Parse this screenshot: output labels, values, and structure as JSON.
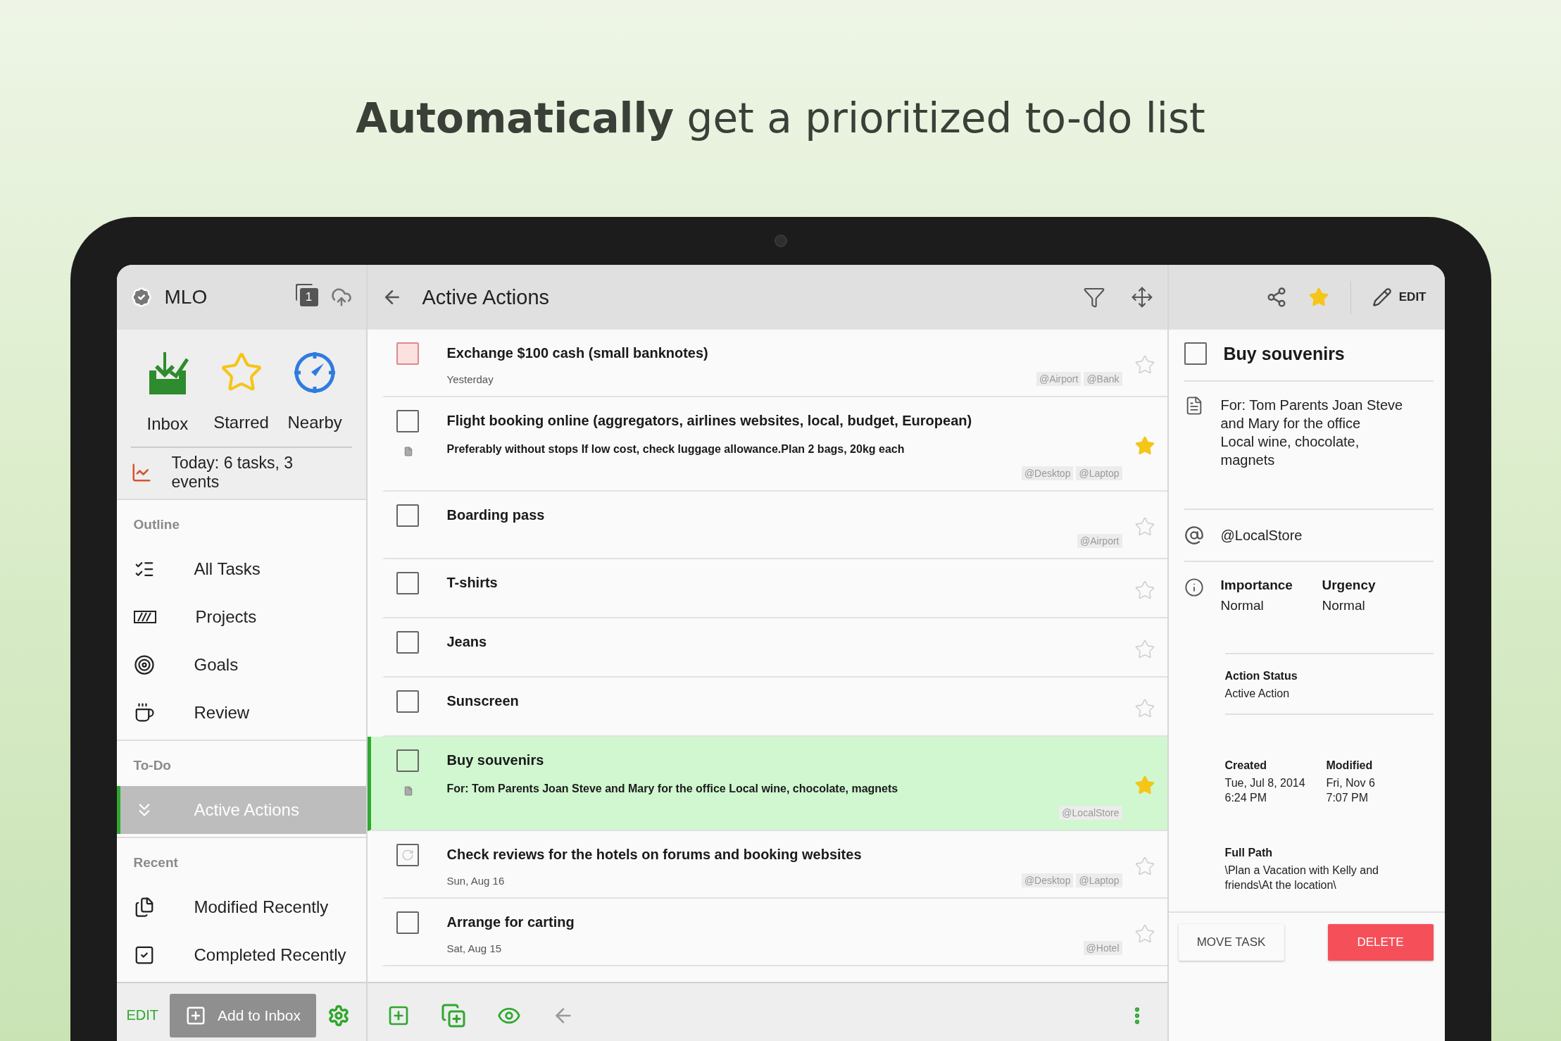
{
  "headline": "**Automatically** get a prioritized to-do list",
  "sidebar": {
    "app_name": "MLO",
    "sync_count": "1",
    "quick": [
      {
        "label": "Inbox",
        "kind": "inbox"
      },
      {
        "label": "Starred",
        "kind": "starred"
      },
      {
        "label": "Nearby",
        "kind": "nearby"
      }
    ],
    "today": "Today: 6 tasks, 3 events",
    "sections": [
      {
        "heading": "Outline",
        "items": [
          {
            "label": "All Tasks",
            "kind": "all",
            "selected": false
          },
          {
            "label": "Projects",
            "kind": "projects",
            "selected": false
          },
          {
            "label": "Goals",
            "kind": "goals",
            "selected": false
          },
          {
            "label": "Review",
            "kind": "review",
            "selected": false
          }
        ]
      },
      {
        "heading": "To-Do",
        "items": [
          {
            "label": "Active Actions",
            "kind": "active",
            "selected": true
          }
        ]
      },
      {
        "heading": "Recent",
        "items": [
          {
            "label": "Modified Recently",
            "kind": "modified",
            "selected": false
          },
          {
            "label": "Completed Recently",
            "kind": "completed",
            "selected": false
          }
        ]
      }
    ],
    "edit": "EDIT",
    "add_button": "Add to Inbox"
  },
  "list": {
    "title": "Active Actions",
    "tasks": [
      {
        "title": "Exchange $100 cash (small banknotes)",
        "kind": "overdue",
        "checked": false,
        "subtitle": "Yesterday",
        "tags": [
          "@Airport",
          "@Bank"
        ],
        "starred": false,
        "selected": false
      },
      {
        "title": "Flight booking online (aggregators, airlines websites, local, budget, European)",
        "kind": "plain",
        "checked": false,
        "note": "Preferably without stops If low cost, check luggage allowance.Plan 2 bags, 20kg each",
        "tags": [
          "@Desktop",
          "@Laptop"
        ],
        "starred": true,
        "selected": false
      },
      {
        "title": "Boarding pass",
        "kind": "plain",
        "checked": false,
        "tags": [
          "@Airport"
        ],
        "starred": false,
        "selected": false
      },
      {
        "title": "T-shirts",
        "kind": "plain",
        "checked": false,
        "starred": false,
        "selected": false
      },
      {
        "title": "Jeans",
        "kind": "plain",
        "checked": false,
        "starred": false,
        "selected": false
      },
      {
        "title": "Sunscreen",
        "kind": "plain",
        "checked": false,
        "starred": false,
        "selected": false
      },
      {
        "title": "Buy souvenirs",
        "kind": "plain",
        "checked": false,
        "note": "For: Tom Parents Joan Steve and Mary for the office Local wine, chocolate, magnets",
        "tags": [
          "@LocalStore"
        ],
        "starred": true,
        "selected": true
      },
      {
        "title": "Check reviews for the hotels on forums and booking websites",
        "kind": "recurring",
        "checked": false,
        "subtitle": "Sun, Aug 16",
        "tags": [
          "@Desktop",
          "@Laptop"
        ],
        "starred": false,
        "selected": false
      },
      {
        "title": "Arrange for carting",
        "kind": "plain",
        "checked": false,
        "subtitle": "Sat, Aug 15",
        "tags": [
          "@Hotel"
        ],
        "starred": false,
        "selected": false
      }
    ]
  },
  "detail": {
    "checked": false,
    "starred": true,
    "edit": "EDIT",
    "title": "Buy souvenirs",
    "note": "For: Tom Parents Joan Steve and Mary for the office\nLocal wine, chocolate, magnets",
    "context": "@LocalStore",
    "importance": {
      "label": "Importance",
      "value": "Normal"
    },
    "urgency": {
      "label": "Urgency",
      "value": "Normal"
    },
    "action_status": {
      "label": "Action Status",
      "value": "Active Action"
    },
    "created": {
      "label": "Created",
      "value": "Tue, Jul 8, 2014\n6:24 PM"
    },
    "modified": {
      "label": "Modified",
      "value": "Fri, Nov 6\n7:07 PM"
    },
    "full_path": {
      "label": "Full Path",
      "value": "\\Plan a Vacation with Kelly and friends\\At the location\\"
    },
    "buttons": [
      "MOVE TASK",
      "DELETE"
    ]
  }
}
